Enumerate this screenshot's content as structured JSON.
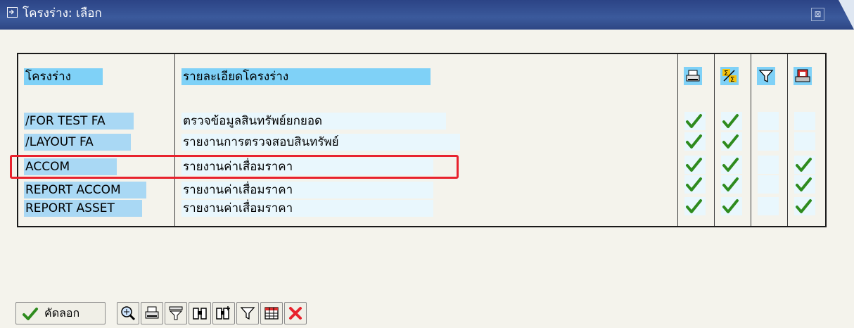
{
  "window": {
    "title": "โครงร่าง: เลือก",
    "close_glyph": "⊠"
  },
  "grid": {
    "headers": {
      "layout": "โครงร่าง",
      "description": "รายละเอียดโครงร่าง",
      "icons": [
        "print-icon",
        "sum-icon",
        "filter-icon",
        "user-icon"
      ]
    },
    "rows": [
      {
        "layout": "/FOR TEST FA",
        "description": "ตรวจข้อมูลสินทรัพย์ยกยอด",
        "checks": [
          true,
          true,
          false,
          false
        ]
      },
      {
        "layout": "/LAYOUT FA",
        "description": "รายงานการตรวจสอบสินทรัพย์",
        "checks": [
          true,
          true,
          false,
          false
        ]
      },
      {
        "layout": "ACCOM",
        "description": "รายงานค่าเสื่อมราคา",
        "checks": [
          true,
          true,
          false,
          true
        ]
      },
      {
        "layout": "REPORT ACCOM",
        "description": "รายงานค่าเสื่อมราคา",
        "checks": [
          true,
          true,
          false,
          true
        ]
      },
      {
        "layout": "REPORT ASSET",
        "description": "รายงานค่าเสื่อมราคา",
        "checks": [
          true,
          true,
          false,
          true
        ]
      }
    ]
  },
  "toolbar": {
    "copy_label": "คัดลอก",
    "buttons": [
      "copy-button",
      "details-button",
      "print-button",
      "sort-button",
      "find-button",
      "find-next-button",
      "filter-button",
      "layout-button",
      "cancel-button"
    ]
  },
  "colors": {
    "title_bar": "#2c4486",
    "header_highlight": "#7fd1f7",
    "cell_selected": "#a9d8f4",
    "checkbox_bg": "#e9f7fd",
    "check_green": "#2e8b1e",
    "annotation_red": "#e8222d"
  }
}
